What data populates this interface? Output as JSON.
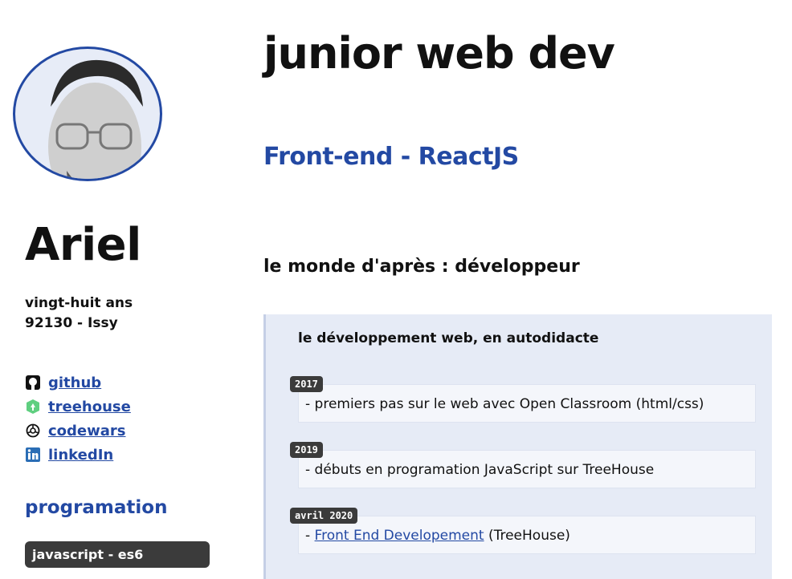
{
  "profile": {
    "name": "Ariel",
    "age": "vingt-huit ans",
    "location": "92130 - Issy"
  },
  "links": [
    {
      "label": "github",
      "icon": "github-icon"
    },
    {
      "label": "treehouse",
      "icon": "treehouse-icon"
    },
    {
      "label": "codewars",
      "icon": "codewars-icon"
    },
    {
      "label": "linkedIn",
      "icon": "linkedin-icon"
    }
  ],
  "skills": {
    "title": "programation",
    "items": [
      "javascript - es6"
    ]
  },
  "header": {
    "title": "junior web dev",
    "subtitle": "Front-end - ReactJS"
  },
  "section": {
    "title": "le monde d'après : développeur",
    "panel_title": "le développement web, en autodidacte",
    "entries": [
      {
        "date": "2017",
        "text": "- premiers pas sur le web avec Open Classroom (html/css)"
      },
      {
        "date": "2019",
        "text": "- débuts en programation JavaScript sur TreeHouse"
      },
      {
        "date": "avril 2020",
        "prefix": "- ",
        "link": "Front End Developement",
        "suffix": " (TreeHouse)"
      }
    ]
  },
  "colors": {
    "accent": "#2349a3",
    "panel_bg": "#e6ebf6",
    "tag_bg": "#3b3b3b"
  }
}
